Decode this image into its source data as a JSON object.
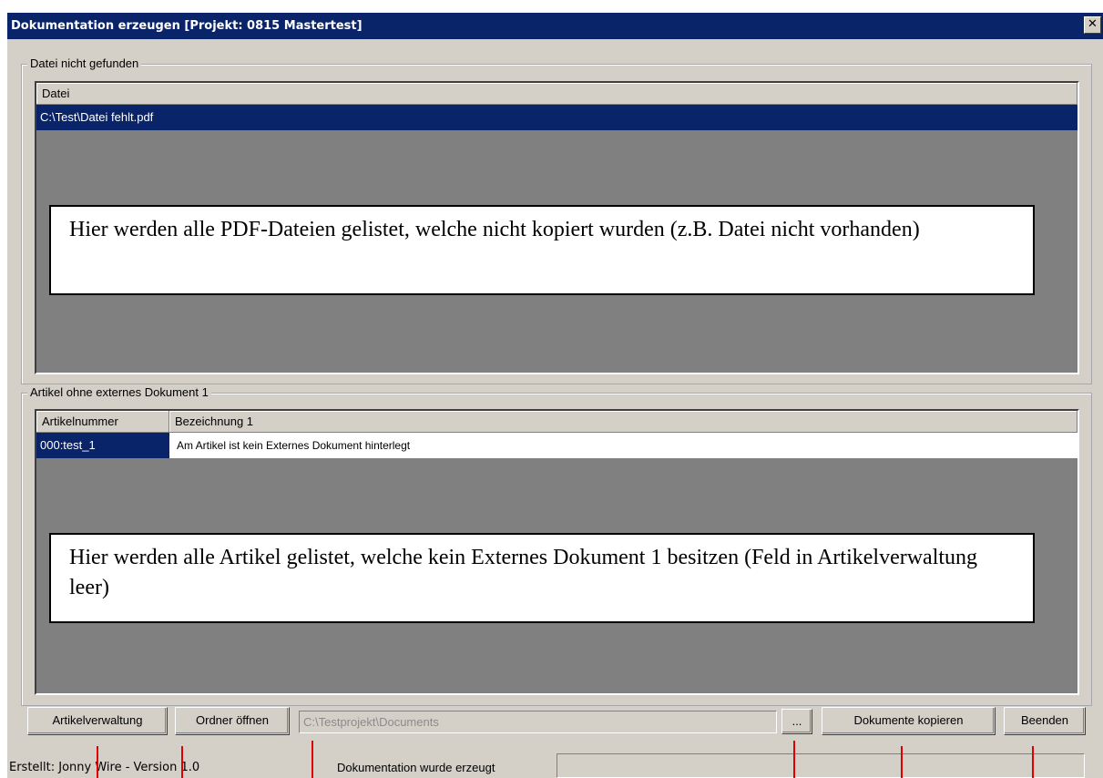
{
  "window": {
    "title": "Dokumentation erzeugen [Projekt: 0815 Mastertest]",
    "close_label": "✕"
  },
  "missing_files": {
    "group_title": "Datei nicht gefunden",
    "columns": [
      "Datei"
    ],
    "rows": [
      [
        "C:\\Test\\Datei fehlt.pdf"
      ]
    ],
    "annotation": "Hier werden alle PDF-Dateien gelistet, welche nicht kopiert wurden (z.B. Datei nicht vorhanden)"
  },
  "missing_documents": {
    "group_title": "Artikel ohne externes Dokument 1",
    "columns": [
      "Artikelnummer",
      "Bezeichnung 1"
    ],
    "rows": [
      [
        "000:test_1",
        "Am Artikel ist kein Externes Dokument hinterlegt"
      ]
    ],
    "annotation": "Hier werden alle Artikel gelistet, welche kein Externes Dokument 1 besitzen (Feld in Artikelverwaltung leer)"
  },
  "toolbar": {
    "article_admin_label": "Artikelverwaltung",
    "open_folder_label": "Ordner öffnen",
    "path_value": "C:\\Testprojekt\\Documents",
    "browse_label": "...",
    "copy_documents_label": "Dokumente kopieren",
    "exit_label": "Beenden"
  },
  "status": {
    "created_by": "Erstellt: Jonny Wire - Version 1.0",
    "message": "Dokumentation wurde erzeugt"
  },
  "colors": {
    "title_bar": "#0a246a",
    "selection": "#0a246a",
    "list_background": "#808080",
    "window_background": "#d4d0c8",
    "marker_lines": "#e00000"
  }
}
